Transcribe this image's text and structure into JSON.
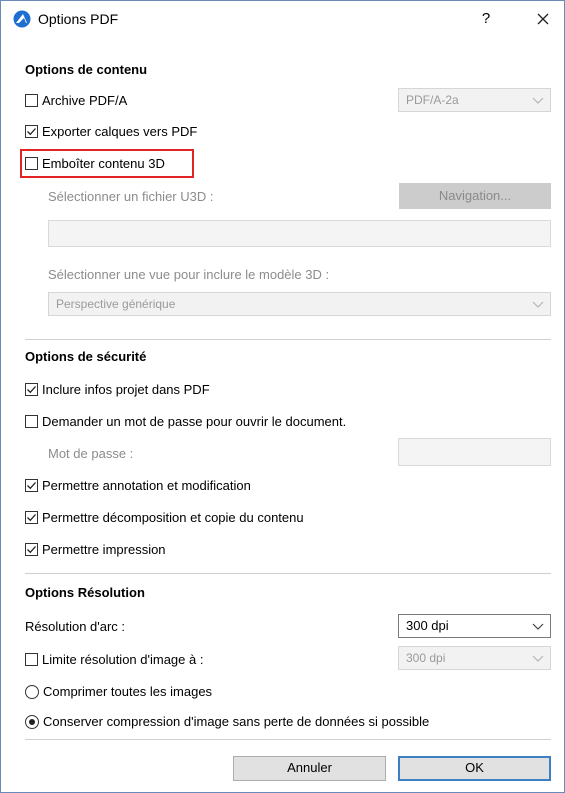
{
  "window": {
    "title": "Options PDF",
    "help_label": "?",
    "accent_color": "#1e6fd0",
    "highlight_color": "#e02424"
  },
  "content_options": {
    "heading": "Options de contenu",
    "archive_pdfa": {
      "label": "Archive PDF/A",
      "checked": false
    },
    "pdfa_select": {
      "value": "PDF/A-2a",
      "enabled": false
    },
    "export_layers": {
      "label": "Exporter calques vers PDF",
      "checked": true
    },
    "embed_3d": {
      "label": "Emboîter contenu 3D",
      "checked": false
    },
    "u3d_label": "Sélectionner un fichier U3D :",
    "browse_button": "Navigation...",
    "u3d_path": "",
    "view_label": "Sélectionner une vue pour inclure le modèle 3D :",
    "view_select": {
      "value": "Perspective générique",
      "enabled": false
    }
  },
  "security_options": {
    "heading": "Options de sécurité",
    "include_project_info": {
      "label": "Inclure infos projet dans PDF",
      "checked": true
    },
    "require_password": {
      "label": "Demander un mot de passe pour ouvrir le document.",
      "checked": false
    },
    "password_label": "Mot de passe :",
    "password_value": "",
    "allow_annotation": {
      "label": "Permettre annotation et modification",
      "checked": true
    },
    "allow_extraction": {
      "label": "Permettre décomposition et copie du contenu",
      "checked": true
    },
    "allow_printing": {
      "label": "Permettre impression",
      "checked": true
    }
  },
  "resolution_options": {
    "heading": "Options Résolution",
    "arc_label": "Résolution d'arc :",
    "arc_select": {
      "value": "300 dpi",
      "enabled": true
    },
    "limit_image": {
      "label": "Limite résolution d'image à :",
      "checked": false
    },
    "image_select": {
      "value": "300 dpi",
      "enabled": false
    },
    "compress_all": {
      "label": "Comprimer toutes les images",
      "selected": false
    },
    "keep_lossless": {
      "label": "Conserver compression d'image sans perte de données si possible",
      "selected": true
    }
  },
  "footer": {
    "cancel_label": "Annuler",
    "ok_label": "OK"
  }
}
